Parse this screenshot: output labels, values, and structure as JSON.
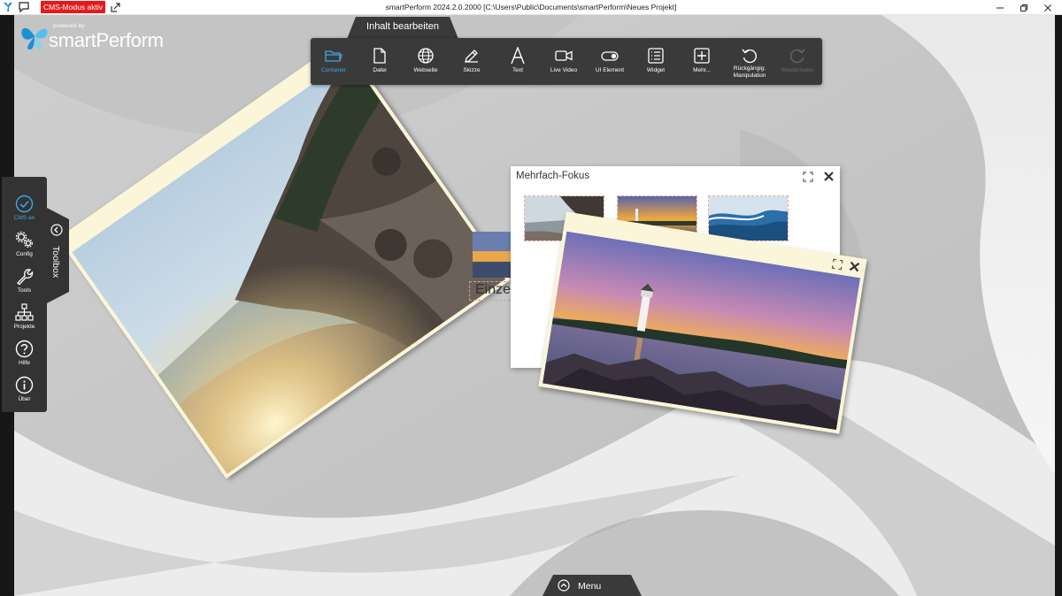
{
  "titlebar": {
    "cms_badge": "CMS-Modus aktiv",
    "title": "smartPerform 2024.2.0.2000 [C:\\Users\\Public\\Documents\\smartPerform\\Neues Projekt]"
  },
  "brand": {
    "powered": "powered by",
    "name": "smartPerform"
  },
  "edit_tab": "Inhalt bearbeiten",
  "toolbar": {
    "items": [
      {
        "label": "Container",
        "icon": "folder-icon",
        "state": "active"
      },
      {
        "label": "Datei",
        "icon": "file-icon",
        "state": "normal"
      },
      {
        "label": "Webseite",
        "icon": "globe-icon",
        "state": "normal"
      },
      {
        "label": "Skizze",
        "icon": "pencil-icon",
        "state": "normal"
      },
      {
        "label": "Text",
        "icon": "text-icon",
        "state": "normal"
      },
      {
        "label": "Live Video",
        "icon": "video-camera-icon",
        "state": "normal"
      },
      {
        "label": "UI Element",
        "icon": "toggle-icon",
        "state": "normal"
      },
      {
        "label": "Widget",
        "icon": "widget-icon",
        "state": "normal"
      },
      {
        "label": "Mehr...",
        "icon": "plus-square-icon",
        "state": "normal"
      },
      {
        "label": "Rückgängig: Manipulation",
        "icon": "undo-icon",
        "state": "normal"
      },
      {
        "label": "Wiederholen",
        "icon": "redo-icon",
        "state": "disabled"
      }
    ]
  },
  "sidebar": {
    "items": [
      {
        "label": "CMS an",
        "icon": "check-circle-icon",
        "active": true
      },
      {
        "label": "Config",
        "icon": "gears-icon",
        "active": false
      },
      {
        "label": "Tools",
        "icon": "wrench-icon",
        "active": false
      },
      {
        "label": "Projekte",
        "icon": "sitemap-icon",
        "active": false
      },
      {
        "label": "Hilfe",
        "icon": "help-icon",
        "active": false
      },
      {
        "label": "Über",
        "icon": "info-icon",
        "active": false
      }
    ],
    "toolbox_label": "Toolbox"
  },
  "bottom_menu": {
    "label": "Menu"
  },
  "canvas": {
    "einzel_label": "Einzel",
    "multi_focus_title": "Mehrfach-Fokus"
  },
  "colors": {
    "accent": "#41a5e6",
    "cms_badge": "#e8191b",
    "panel": "#3a3a3a",
    "window_frame": "#fbf5d9"
  }
}
